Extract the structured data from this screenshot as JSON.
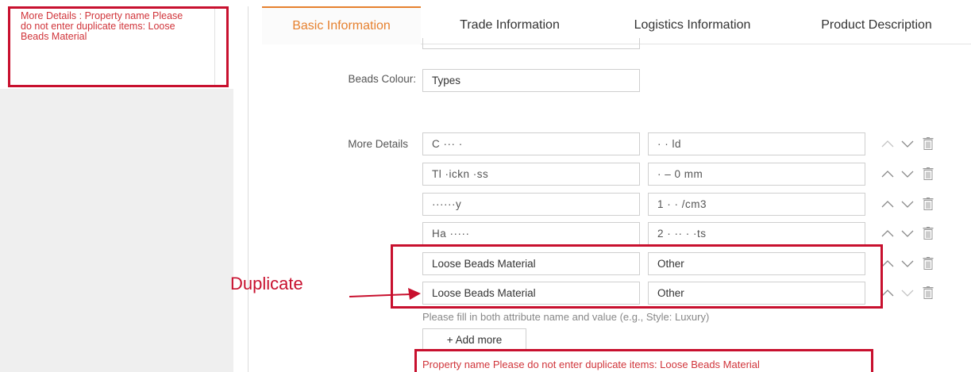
{
  "sidebar": {
    "note_text": "More Details : Property name Please do not enter duplicate items: Loose Beads Material"
  },
  "tabs": [
    {
      "label": "Basic Information",
      "active": true
    },
    {
      "label": "Trade Information",
      "active": false
    },
    {
      "label": "Logistics Information",
      "active": false
    },
    {
      "label": "Product Description",
      "active": false
    }
  ],
  "beads_colour": {
    "label": "Beads Colour:",
    "value": "Types"
  },
  "more_details": {
    "label": "More Details",
    "rows": [
      {
        "name": "C ··· ·",
        "value": "· · ld"
      },
      {
        "name": "Tl ·ickn ·ss",
        "value": "· – 0 mm"
      },
      {
        "name": "······y",
        "value": "1 · · /cm3"
      },
      {
        "name": "Ha ·····",
        "value": "2 · ·· · ·ts"
      },
      {
        "name": "Loose Beads Material",
        "value": "Other"
      },
      {
        "name": "Loose Beads Material",
        "value": "Other"
      }
    ],
    "hint": "Please fill in both attribute name and value (e.g., Style: Luxury)",
    "add_more_label": "+ Add more",
    "error": "Property name Please do not enter duplicate items: Loose Beads Material"
  },
  "annotation": {
    "label": "Duplicate"
  },
  "icons": {
    "move_up": "chevron-up-icon",
    "move_down": "chevron-down-icon",
    "delete": "trash-icon"
  },
  "colors": {
    "accent": "#e6812f",
    "error": "#d0343a",
    "annotation": "#c8102e",
    "sidebar_bg": "#efefef"
  }
}
